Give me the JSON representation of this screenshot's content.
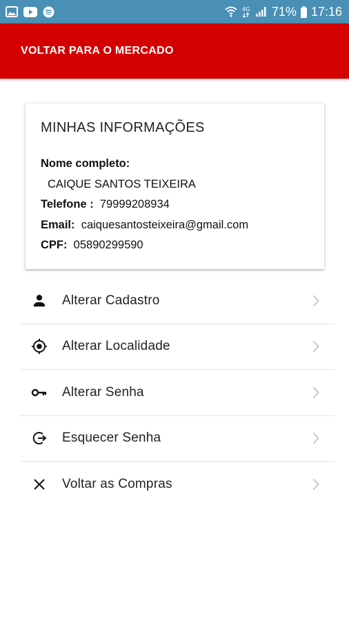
{
  "status_bar": {
    "battery_percent": "71%",
    "time": "17:16",
    "icons_left": [
      "gallery-icon",
      "youtube-icon",
      "spotify-icon"
    ],
    "icons_right": [
      "wifi-icon",
      "4g-icon",
      "signal-icon",
      "battery-icon"
    ]
  },
  "app_bar": {
    "title": "VOLTAR PARA O MERCADO",
    "color": "#d40000"
  },
  "info_card": {
    "title": "MINHAS INFORMAÇÕES",
    "name_label": "Nome completo:",
    "name_value": "CAIQUE SANTOS TEIXEIRA",
    "phone_label": "Telefone :",
    "phone_value": "79999208934",
    "email_label": "Email:",
    "email_value": "caiquesantosteixeira@gmail.com",
    "cpf_label": "CPF:",
    "cpf_value": "05890299590"
  },
  "menu": {
    "items": [
      {
        "label": "Alterar Cadastro",
        "icon": "person-icon"
      },
      {
        "label": "Alterar Localidade",
        "icon": "location-target-icon"
      },
      {
        "label": "Alterar Senha",
        "icon": "key-icon"
      },
      {
        "label": "Esquecer Senha",
        "icon": "logout-icon"
      },
      {
        "label": "Voltar as Compras",
        "icon": "close-icon"
      }
    ]
  }
}
